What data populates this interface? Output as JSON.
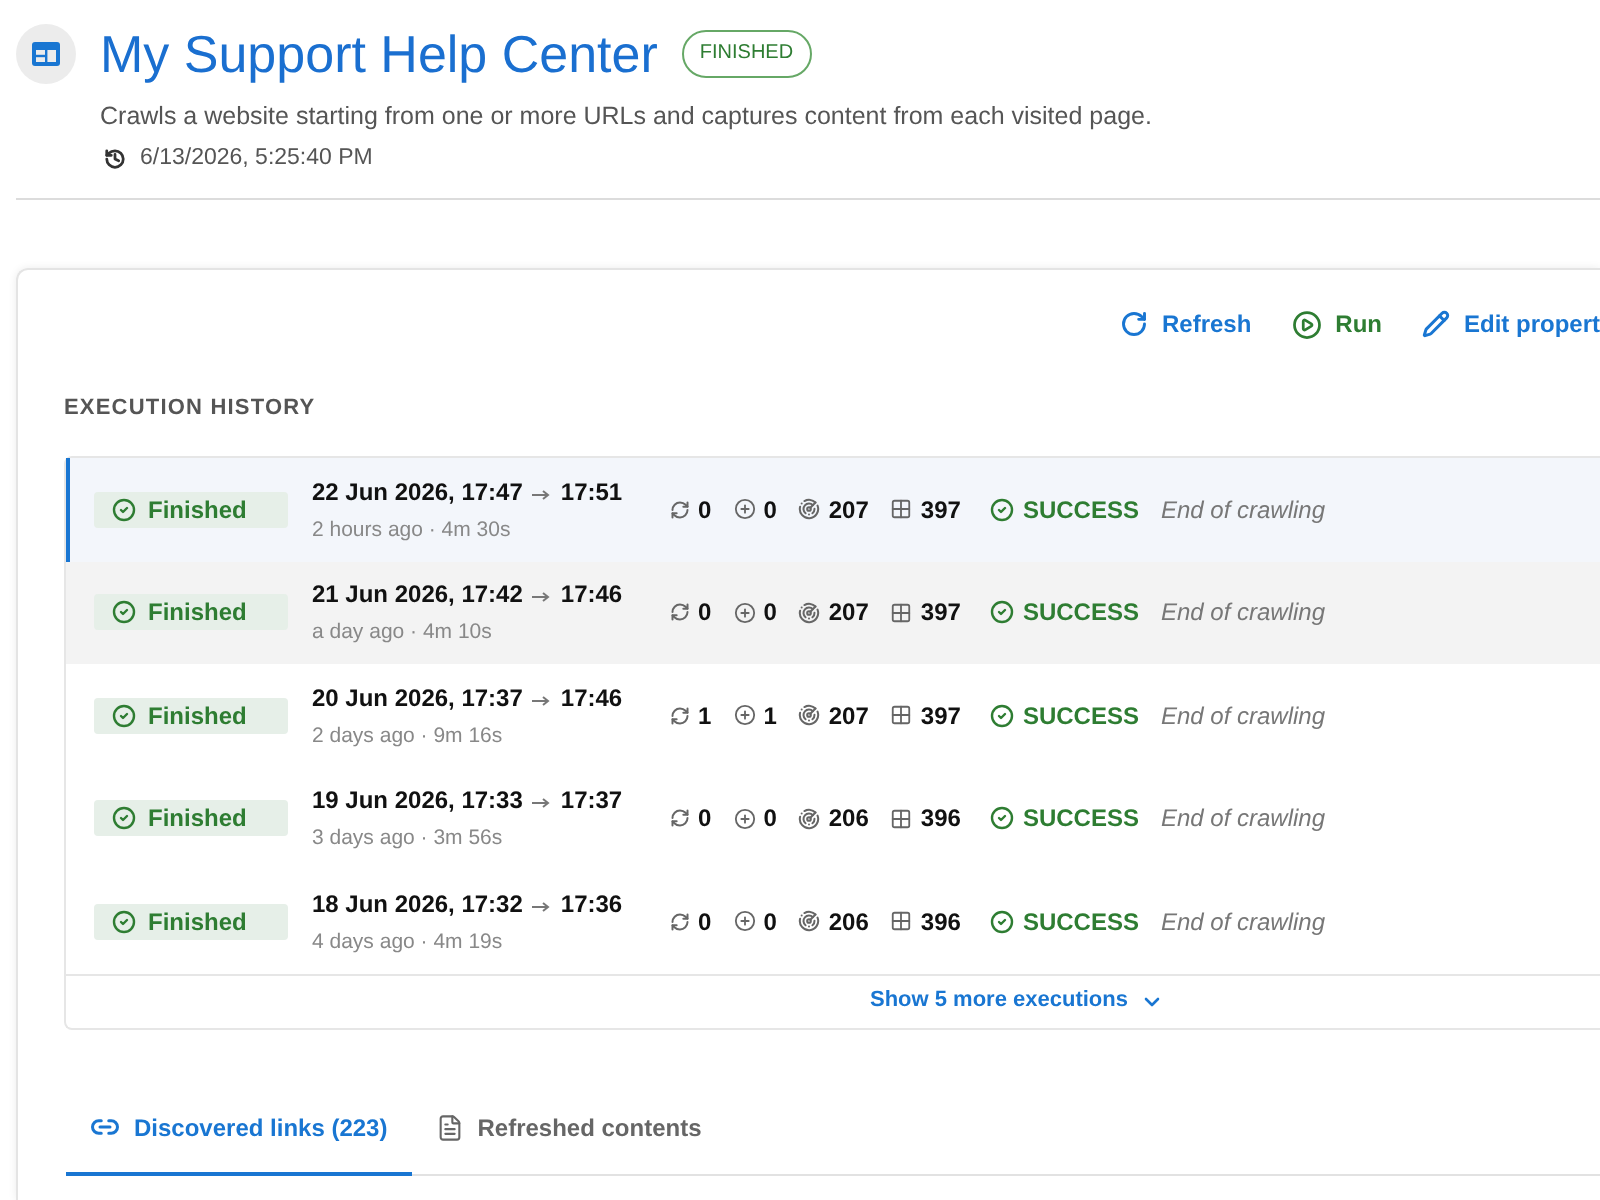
{
  "header": {
    "title": "My Support Help Center",
    "status_badge": "FINISHED",
    "description": "Crawls a website starting from one or more URLs and captures content from each visited page.",
    "timestamp": "6/13/2026, 5:25:40 PM"
  },
  "toolbar": [
    {
      "label": "Refresh",
      "kind": "refresh"
    },
    {
      "label": "Run",
      "kind": "run"
    },
    {
      "label": "Edit propert",
      "kind": "edit"
    }
  ],
  "execution_history": {
    "title": "EXECUTION HISTORY",
    "rows": [
      {
        "status": "Finished",
        "start": "22 Jun 2026, 17:47",
        "end": "17:51",
        "relative": "2 hours ago · 4m 30s",
        "count_1": "0",
        "count_2": "0",
        "count_3": "207",
        "count_4": "397",
        "result": "SUCCESS",
        "message": "End of crawling",
        "selected": true,
        "hovered": false
      },
      {
        "status": "Finished",
        "start": "21 Jun 2026, 17:42",
        "end": "17:46",
        "relative": "a day ago · 4m 10s",
        "count_1": "0",
        "count_2": "0",
        "count_3": "207",
        "count_4": "397",
        "result": "SUCCESS",
        "message": "End of crawling",
        "selected": false,
        "hovered": true
      },
      {
        "status": "Finished",
        "start": "20 Jun 2026, 17:37",
        "end": "17:46",
        "relative": "2 days ago · 9m 16s",
        "count_1": "1",
        "count_2": "1",
        "count_3": "207",
        "count_4": "397",
        "result": "SUCCESS",
        "message": "End of crawling",
        "selected": false,
        "hovered": false
      },
      {
        "status": "Finished",
        "start": "19 Jun 2026, 17:33",
        "end": "17:37",
        "relative": "3 days ago · 3m 56s",
        "count_1": "0",
        "count_2": "0",
        "count_3": "206",
        "count_4": "396",
        "result": "SUCCESS",
        "message": "End of crawling",
        "selected": false,
        "hovered": false
      },
      {
        "status": "Finished",
        "start": "18 Jun 2026, 17:32",
        "end": "17:36",
        "relative": "4 days ago · 4m 19s",
        "count_1": "0",
        "count_2": "0",
        "count_3": "206",
        "count_4": "396",
        "result": "SUCCESS",
        "message": "End of crawling",
        "selected": false,
        "hovered": false
      }
    ],
    "show_more": "Show 5 more executions"
  },
  "tabs": [
    {
      "label": "Discovered links (223)",
      "kind": "links",
      "selected": true
    },
    {
      "label": "Refreshed contents",
      "kind": "contents",
      "selected": false
    }
  ]
}
